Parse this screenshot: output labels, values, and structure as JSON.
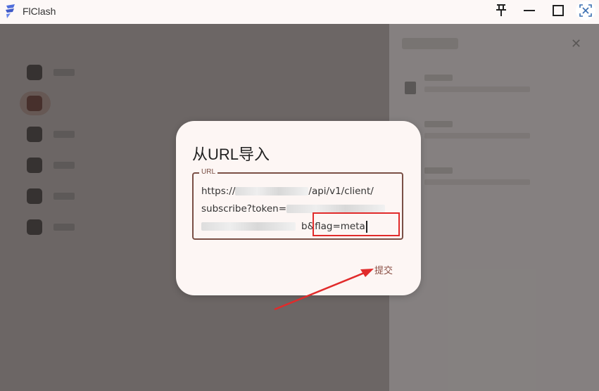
{
  "window": {
    "title": "FlClash",
    "controls": {
      "pin_icon": "pin-icon",
      "minimize_icon": "minimize-icon",
      "maximize_icon": "maximize-icon",
      "close_icon": "close-icon"
    }
  },
  "colors": {
    "accent": "#8a4f44",
    "annotation": "#e12b2b"
  },
  "dialog": {
    "title": "从URL导入",
    "field_label": "URL",
    "url_line1_prefix": "https://",
    "url_line1_suffix": "/api/v1/client/",
    "url_line2_prefix": "subscribe?token=",
    "url_line3_suffix": "b&flag=meta",
    "submit_label": "提交"
  }
}
